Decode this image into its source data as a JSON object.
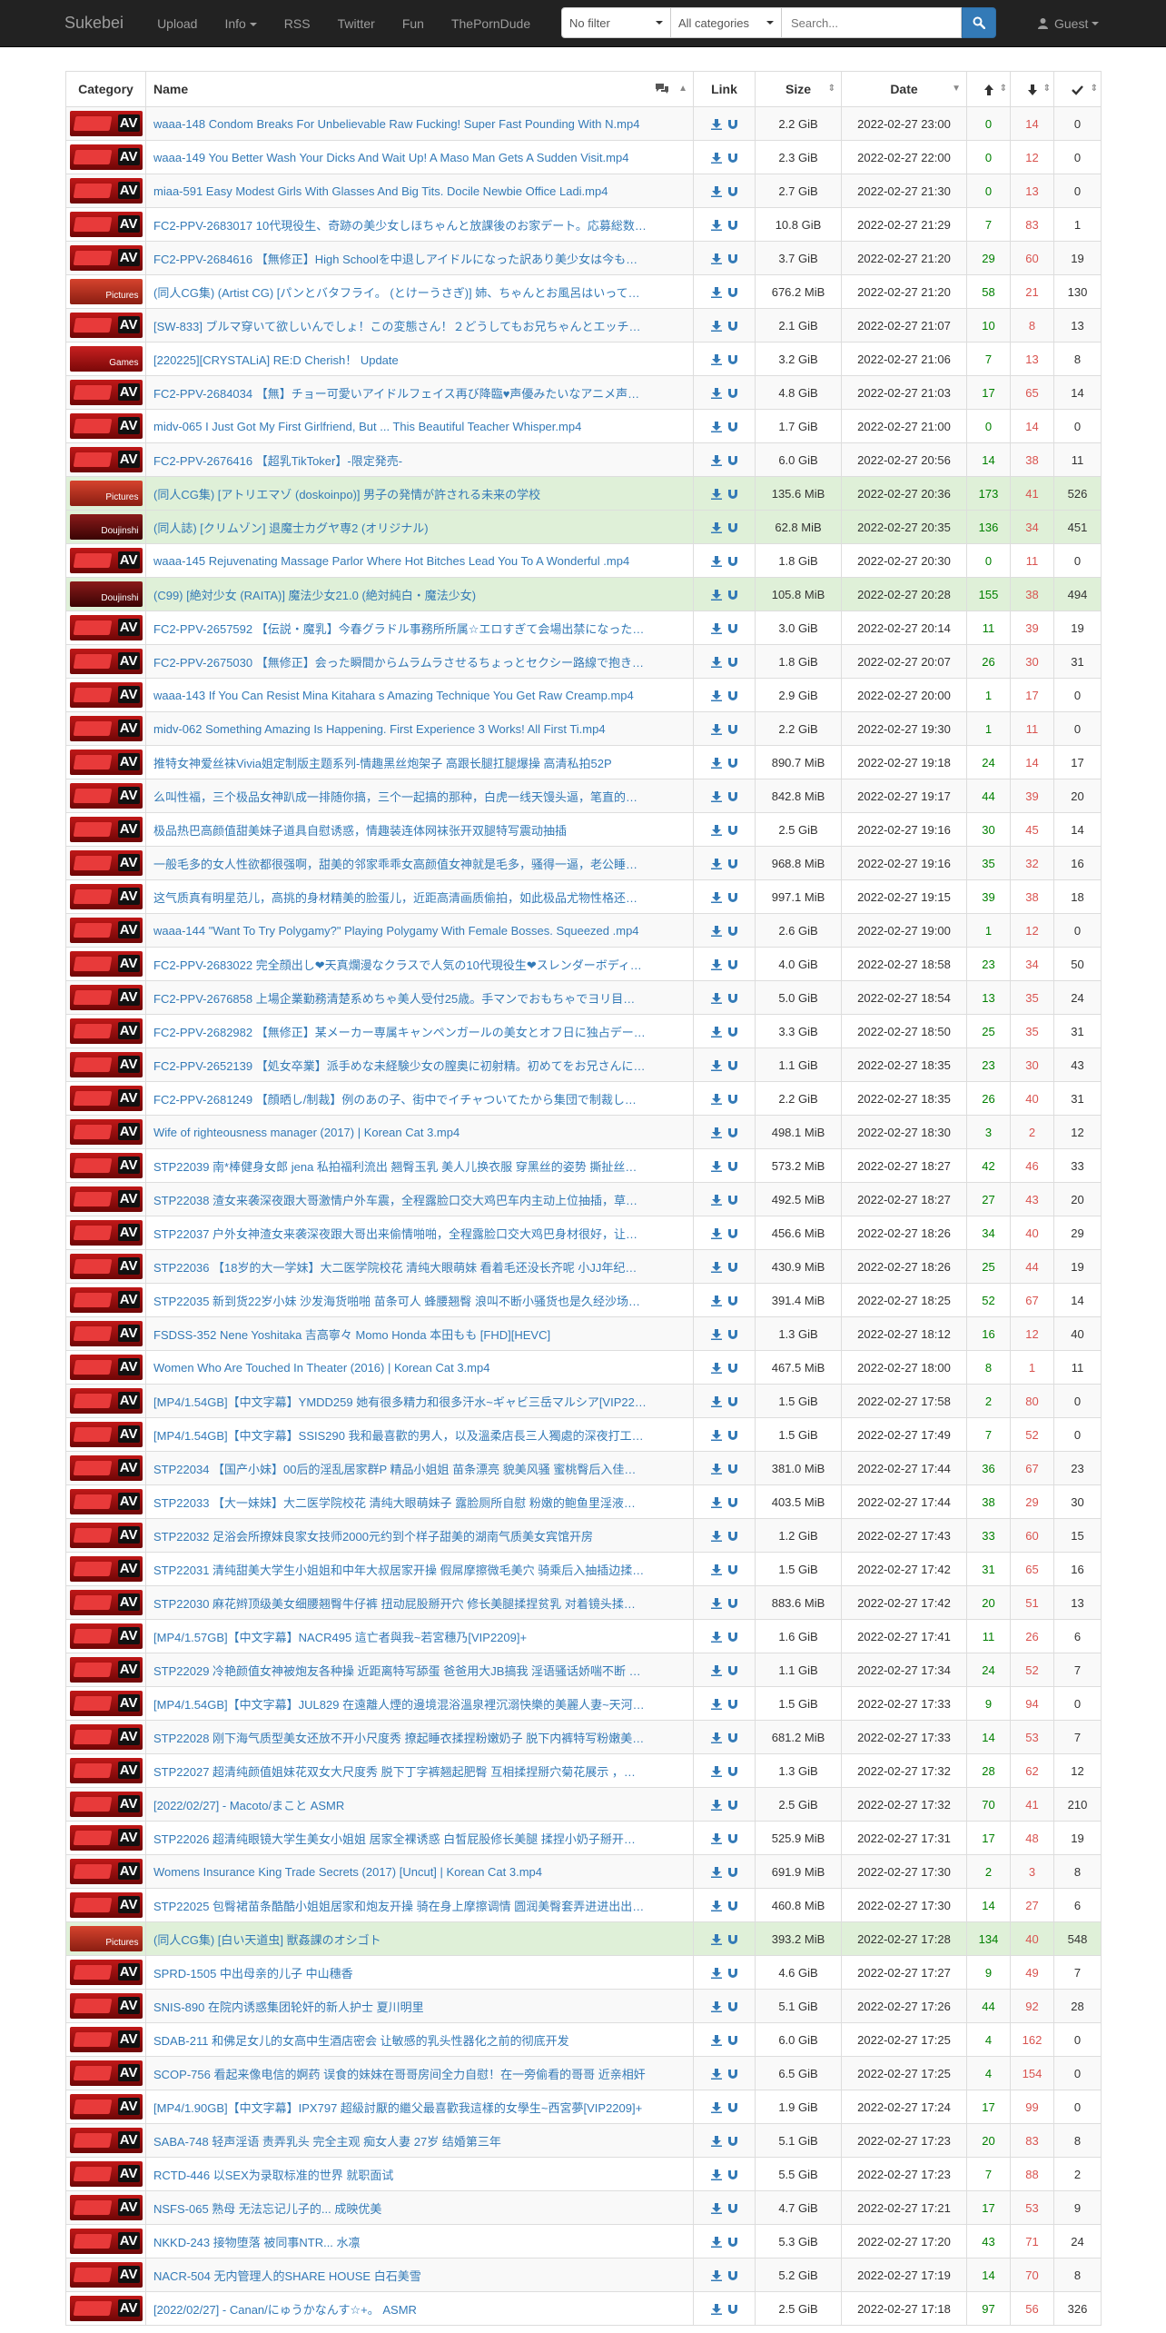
{
  "nav": {
    "brand": "Sukebei",
    "links": [
      "Upload",
      "Info",
      "RSS",
      "Twitter",
      "Fun",
      "ThePornDude"
    ],
    "filter": "No filter",
    "category": "All categories",
    "search_placeholder": "Search...",
    "user": "Guest"
  },
  "table": {
    "headers": {
      "category": "Category",
      "name": "Name",
      "link": "Link",
      "size": "Size",
      "date": "Date"
    },
    "rows": [
      {
        "cat": "AV",
        "name": "waaa-148 Condom Breaks For Unbelievable Raw Fucking! Super Fast Pounding With N.mp4",
        "size": "2.2 GiB",
        "date": "2022-02-27 23:00",
        "se": "0",
        "le": "14",
        "dl": "0",
        "success": false
      },
      {
        "cat": "AV",
        "name": "waaa-149 You Better Wash Your Dicks And Wait Up! A Maso Man Gets A Sudden Visit.mp4",
        "size": "2.3 GiB",
        "date": "2022-02-27 22:00",
        "se": "0",
        "le": "12",
        "dl": "0",
        "success": false
      },
      {
        "cat": "AV",
        "name": "miaa-591 Easy Modest Girls With Glasses And Big Tits. Docile Newbie Office Ladi.mp4",
        "size": "2.7 GiB",
        "date": "2022-02-27 21:30",
        "se": "0",
        "le": "13",
        "dl": "0",
        "success": false
      },
      {
        "cat": "AV",
        "name": "FC2-PPV-2683017 10代現役生、奇跡の美少女しほちゃんと放課後のお家デート。応募総数…",
        "size": "10.8 GiB",
        "date": "2022-02-27 21:29",
        "se": "7",
        "le": "83",
        "dl": "1",
        "success": false
      },
      {
        "cat": "AV",
        "name": "FC2-PPV-2684616 【無修正】High Schoolを中退しアイドルになった訳あり美少女は今も…",
        "size": "3.7 GiB",
        "date": "2022-02-27 21:20",
        "se": "29",
        "le": "60",
        "dl": "19",
        "success": false
      },
      {
        "cat": "Pictures",
        "name": "(同人CG集) (Artist CG) [パンとバタフライ。 (とけーうさぎ)] 姉、ちゃんとお風呂はいって…",
        "size": "676.2 MiB",
        "date": "2022-02-27 21:20",
        "se": "58",
        "le": "21",
        "dl": "130",
        "success": false
      },
      {
        "cat": "AV",
        "name": "[SW-833] ブルマ穿いて欲しいんでしょ！この変態さん！２どうしてもお兄ちゃんとエッチ…",
        "size": "2.1 GiB",
        "date": "2022-02-27 21:07",
        "se": "10",
        "le": "8",
        "dl": "13",
        "success": false
      },
      {
        "cat": "Games",
        "name": "[220225][CRYSTALiA] RE:D Cherish！ Update",
        "size": "3.2 GiB",
        "date": "2022-02-27 21:06",
        "se": "7",
        "le": "13",
        "dl": "8",
        "success": false
      },
      {
        "cat": "AV",
        "name": "FC2-PPV-2684034 【無】チョー可愛いアイドルフェイス再び降臨♥声優みたいなアニメ声…",
        "size": "4.8 GiB",
        "date": "2022-02-27 21:03",
        "se": "17",
        "le": "65",
        "dl": "14",
        "success": false
      },
      {
        "cat": "AV",
        "name": "midv-065 I Just Got My First Girlfriend, But ... This Beautiful Teacher Whisper.mp4",
        "size": "1.7 GiB",
        "date": "2022-02-27 21:00",
        "se": "0",
        "le": "14",
        "dl": "0",
        "success": false
      },
      {
        "cat": "AV",
        "name": "FC2-PPV-2676416 【超乳TikToker】-限定発売-",
        "size": "6.0 GiB",
        "date": "2022-02-27 20:56",
        "se": "14",
        "le": "38",
        "dl": "11",
        "success": false
      },
      {
        "cat": "Pictures",
        "name": "(同人CG集) [アトリエマゾ (doskoinpo)] 男子の発情が許される未来の学校",
        "size": "135.6 MiB",
        "date": "2022-02-27 20:36",
        "se": "173",
        "le": "41",
        "dl": "526",
        "success": true
      },
      {
        "cat": "Doujinshi",
        "name": "(同人誌) [クリムゾン] 退魔士カグヤ専2 (オリジナル)",
        "size": "62.8 MiB",
        "date": "2022-02-27 20:35",
        "se": "136",
        "le": "34",
        "dl": "451",
        "success": true
      },
      {
        "cat": "AV",
        "name": "waaa-145 Rejuvenating Massage Parlor Where Hot Bitches Lead You To A Wonderful .mp4",
        "size": "1.8 GiB",
        "date": "2022-02-27 20:30",
        "se": "0",
        "le": "11",
        "dl": "0",
        "success": false
      },
      {
        "cat": "Doujinshi",
        "name": "(C99) [絶対少女 (RAITA)] 魔法少女21.0 (絶対純白・魔法少女)",
        "size": "105.8 MiB",
        "date": "2022-02-27 20:28",
        "se": "155",
        "le": "38",
        "dl": "494",
        "success": true
      },
      {
        "cat": "AV",
        "name": "FC2-PPV-2657592 【伝説・魔乳】今春グラドル事務所所属☆エロすぎて会場出禁になった…",
        "size": "3.0 GiB",
        "date": "2022-02-27 20:14",
        "se": "11",
        "le": "39",
        "dl": "19",
        "success": false
      },
      {
        "cat": "AV",
        "name": "FC2-PPV-2675030 【無修正】会った瞬間からムラムラさせるちょっとセクシー路線で抱き…",
        "size": "1.8 GiB",
        "date": "2022-02-27 20:07",
        "se": "26",
        "le": "30",
        "dl": "31",
        "success": false
      },
      {
        "cat": "AV",
        "name": "waaa-143 If You Can Resist Mina Kitahara s Amazing Technique You Get Raw Creamp.mp4",
        "size": "2.9 GiB",
        "date": "2022-02-27 20:00",
        "se": "1",
        "le": "17",
        "dl": "0",
        "success": false
      },
      {
        "cat": "AV",
        "name": "midv-062 Something Amazing Is Happening. First Experience 3 Works! All First Ti.mp4",
        "size": "2.2 GiB",
        "date": "2022-02-27 19:30",
        "se": "1",
        "le": "11",
        "dl": "0",
        "success": false
      },
      {
        "cat": "AV",
        "name": "推特女神爱丝袜Vivia姐定制版主题系列-情趣黑丝炮架子 高跟长腿扛腿爆操 高清私拍52P",
        "size": "890.7 MiB",
        "date": "2022-02-27 19:18",
        "se": "24",
        "le": "14",
        "dl": "17",
        "success": false
      },
      {
        "cat": "AV",
        "name": "么叫性福，三个极品女神趴成一排随你搞，三个一起搞的那种，白虎一线天馒头逼，笔直的…",
        "size": "842.8 MiB",
        "date": "2022-02-27 19:17",
        "se": "44",
        "le": "39",
        "dl": "20",
        "success": false
      },
      {
        "cat": "AV",
        "name": "极品热巴高颜值甜美妹子道具自慰诱惑，情趣装连体网袜张开双腿特写震动抽插",
        "size": "2.5 GiB",
        "date": "2022-02-27 19:16",
        "se": "30",
        "le": "45",
        "dl": "14",
        "success": false
      },
      {
        "cat": "AV",
        "name": "一般毛多的女人性欲都很强啊，甜美的邻家乖乖女高颜值女神就是毛多，骚得一逼，老公睡…",
        "size": "968.8 MiB",
        "date": "2022-02-27 19:16",
        "se": "35",
        "le": "32",
        "dl": "16",
        "success": false
      },
      {
        "cat": "AV",
        "name": "这气质真有明星范儿，高挑的身材精美的脸蛋儿，近距高清画质偷拍，如此极品尤物性格还…",
        "size": "997.1 MiB",
        "date": "2022-02-27 19:15",
        "se": "39",
        "le": "38",
        "dl": "18",
        "success": false
      },
      {
        "cat": "AV",
        "name": "waaa-144 \"Want To Try Polygamy?\" Playing Polygamy With Female Bosses. Squeezed .mp4",
        "size": "2.6 GiB",
        "date": "2022-02-27 19:00",
        "se": "1",
        "le": "12",
        "dl": "0",
        "success": false
      },
      {
        "cat": "AV",
        "name": "FC2-PPV-2683022 完全顔出し❤天真爛漫なクラスで人気の10代現役生❤スレンダーボディ…",
        "size": "4.0 GiB",
        "date": "2022-02-27 18:58",
        "se": "23",
        "le": "34",
        "dl": "50",
        "success": false
      },
      {
        "cat": "AV",
        "name": "FC2-PPV-2676858 上場企業勤務清楚系めちゃ美人受付25歳。手マンでおもちゃでヨリ目…",
        "size": "5.0 GiB",
        "date": "2022-02-27 18:54",
        "se": "13",
        "le": "35",
        "dl": "24",
        "success": false
      },
      {
        "cat": "AV",
        "name": "FC2-PPV-2682982 【無修正】某メーカー専属キャンペンガールの美女とオフ日に独占デー…",
        "size": "3.3 GiB",
        "date": "2022-02-27 18:50",
        "se": "25",
        "le": "35",
        "dl": "31",
        "success": false
      },
      {
        "cat": "AV",
        "name": "FC2-PPV-2652139 【処女卒業】派手めな未経験少女の膣奥に初射精。初めてをお兄さんに…",
        "size": "1.1 GiB",
        "date": "2022-02-27 18:35",
        "se": "23",
        "le": "30",
        "dl": "43",
        "success": false
      },
      {
        "cat": "AV",
        "name": "FC2-PPV-2681249 【顔晒し/制裁】例のあの子、街中でイチャついてたから集団で制裁し…",
        "size": "2.2 GiB",
        "date": "2022-02-27 18:35",
        "se": "26",
        "le": "40",
        "dl": "31",
        "success": false
      },
      {
        "cat": "AV",
        "name": "Wife of righteousness manager (2017) | Korean Cat 3.mp4",
        "size": "498.1 MiB",
        "date": "2022-02-27 18:30",
        "se": "3",
        "le": "2",
        "dl": "12",
        "success": false
      },
      {
        "cat": "AV",
        "name": "STP22039 南*棒健身女郎 jena 私拍福利流出 翘臀玉乳 美人儿换衣服 穿黑丝的姿势 撕扯丝…",
        "size": "573.2 MiB",
        "date": "2022-02-27 18:27",
        "se": "42",
        "le": "46",
        "dl": "33",
        "success": false
      },
      {
        "cat": "AV",
        "name": "STP22038 渣女来袭深夜跟大哥激情户外车震，全程露脸口交大鸡巴车内主动上位抽插，草…",
        "size": "492.5 MiB",
        "date": "2022-02-27 18:27",
        "se": "27",
        "le": "43",
        "dl": "20",
        "success": false
      },
      {
        "cat": "AV",
        "name": "STP22037 户外女神渣女来袭深夜跟大哥出来偷情啪啪，全程露脸口交大鸡巴身材很好，让…",
        "size": "456.6 MiB",
        "date": "2022-02-27 18:26",
        "se": "34",
        "le": "40",
        "dl": "29",
        "success": false
      },
      {
        "cat": "AV",
        "name": "STP22036 【18岁的大一学妹】大二医学院校花 清纯大眼萌妹 看着毛还没长齐呢 小JJ年纪…",
        "size": "430.9 MiB",
        "date": "2022-02-27 18:26",
        "se": "25",
        "le": "44",
        "dl": "19",
        "success": false
      },
      {
        "cat": "AV",
        "name": "STP22035 新到货22岁小妹 沙发海货啪啪 苗条可人 蜂腰翘臀 浪叫不断小骚货也是久经沙场…",
        "size": "391.4 MiB",
        "date": "2022-02-27 18:25",
        "se": "52",
        "le": "67",
        "dl": "14",
        "success": false
      },
      {
        "cat": "AV",
        "name": "FSDSS-352 Nene Yoshitaka 吉高寧々 Momo Honda 本田もも [FHD][HEVC]",
        "size": "1.3 GiB",
        "date": "2022-02-27 18:12",
        "se": "16",
        "le": "12",
        "dl": "40",
        "success": false
      },
      {
        "cat": "AV",
        "name": "Women Who Are Touched In Theater (2016) | Korean Cat 3.mp4",
        "size": "467.5 MiB",
        "date": "2022-02-27 18:00",
        "se": "8",
        "le": "1",
        "dl": "11",
        "success": false
      },
      {
        "cat": "AV",
        "name": "[MP4/1.54GB]【中文字幕】YMDD259 她有很多精力和很多汗水~ギャビ三岳マルシア[VIP22…",
        "size": "1.5 GiB",
        "date": "2022-02-27 17:58",
        "se": "2",
        "le": "80",
        "dl": "0",
        "success": false
      },
      {
        "cat": "AV",
        "name": "[MP4/1.54GB]【中文字幕】SSIS290 我和最喜歡的男人，以及溫柔店長三人獨處的深夜打工…",
        "size": "1.5 GiB",
        "date": "2022-02-27 17:49",
        "se": "7",
        "le": "52",
        "dl": "0",
        "success": false
      },
      {
        "cat": "AV",
        "name": "STP22034 【国产小妹】00后的淫乱居家群P 精品小姐姐 苗条漂亮 貌美风骚 蜜桃臀后入佳…",
        "size": "381.0 MiB",
        "date": "2022-02-27 17:44",
        "se": "36",
        "le": "67",
        "dl": "23",
        "success": false
      },
      {
        "cat": "AV",
        "name": "STP22033 【大一妹妹】大二医学院校花 清纯大眼萌妹子 露脸厕所自慰 粉嫩的鲍鱼里淫液…",
        "size": "403.5 MiB",
        "date": "2022-02-27 17:44",
        "se": "38",
        "le": "29",
        "dl": "30",
        "success": false
      },
      {
        "cat": "AV",
        "name": "STP22032 足浴会所撩妹良家女技师2000元约到个样子甜美的湖南气质美女宾馆开房",
        "size": "1.2 GiB",
        "date": "2022-02-27 17:43",
        "se": "33",
        "le": "60",
        "dl": "15",
        "success": false
      },
      {
        "cat": "AV",
        "name": "STP22031 清纯甜美大学生小姐姐和中年大叔居家开操 假屌摩擦微毛美穴 骑乘后入抽插边揉…",
        "size": "1.5 GiB",
        "date": "2022-02-27 17:42",
        "se": "31",
        "le": "65",
        "dl": "16",
        "success": false
      },
      {
        "cat": "AV",
        "name": "STP22030 麻花辫顶级美女细腰翘臀牛仔裤 扭动屁股掰开穴 修长美腿揉捏贫乳 对着镜头揉…",
        "size": "883.6 MiB",
        "date": "2022-02-27 17:42",
        "se": "20",
        "le": "51",
        "dl": "13",
        "success": false
      },
      {
        "cat": "AV",
        "name": "[MP4/1.57GB]【中文字幕】NACR495 這亡者與我~若宮穗乃[VIP2209]+",
        "size": "1.6 GiB",
        "date": "2022-02-27 17:41",
        "se": "11",
        "le": "26",
        "dl": "6",
        "success": false
      },
      {
        "cat": "AV",
        "name": "STP22029 冷艳颜值女神被炮友各种操 近距离特写舔蛋 爸爸用大JB搞我 淫语骚话娇喘不断 …",
        "size": "1.1 GiB",
        "date": "2022-02-27 17:34",
        "se": "24",
        "le": "52",
        "dl": "7",
        "success": false
      },
      {
        "cat": "AV",
        "name": "[MP4/1.54GB]【中文字幕】JUL829 在遠離人煙的邊境混浴溫泉裡沉溺快樂的美麗人妻~天河…",
        "size": "1.5 GiB",
        "date": "2022-02-27 17:33",
        "se": "9",
        "le": "94",
        "dl": "0",
        "success": false
      },
      {
        "cat": "AV",
        "name": "STP22028 刚下海气质型美女还放不开小尺度秀 撩起睡衣揉捏粉嫩奶子 脱下内裤特写粉嫩美…",
        "size": "681.2 MiB",
        "date": "2022-02-27 17:33",
        "se": "14",
        "le": "53",
        "dl": "7",
        "success": false
      },
      {
        "cat": "AV",
        "name": "STP22027 超清纯颜值姐妹花双女大尺度秀 脱下丁字裤翘起肥臀 互相揉捏掰穴菊花展示 ，…",
        "size": "1.3 GiB",
        "date": "2022-02-27 17:32",
        "se": "28",
        "le": "62",
        "dl": "12",
        "success": false
      },
      {
        "cat": "AV",
        "name": "[2022/02/27] - Macoto/まこと ASMR",
        "size": "2.5 GiB",
        "date": "2022-02-27 17:32",
        "se": "70",
        "le": "41",
        "dl": "210",
        "success": false
      },
      {
        "cat": "AV",
        "name": "STP22026 超清纯眼镜大学生美女小姐姐 居家全裸诱惑 白皙屁股修长美腿 揉捏小奶子掰开…",
        "size": "525.9 MiB",
        "date": "2022-02-27 17:31",
        "se": "17",
        "le": "48",
        "dl": "19",
        "success": false
      },
      {
        "cat": "AV",
        "name": "Womens Insurance King Trade Secrets (2017) [Uncut] | Korean Cat 3.mp4",
        "size": "691.9 MiB",
        "date": "2022-02-27 17:30",
        "se": "2",
        "le": "3",
        "dl": "8",
        "success": false
      },
      {
        "cat": "AV",
        "name": "STP22025 包臀裙苗条酷酷小姐姐居家和炮友开操 骑在身上摩擦调情 圆润美臀套弄进进出出…",
        "size": "460.8 MiB",
        "date": "2022-02-27 17:30",
        "se": "14",
        "le": "27",
        "dl": "6",
        "success": false
      },
      {
        "cat": "Pictures",
        "name": "(同人CG集) [白い天道虫] 獣姦課のオシゴト",
        "size": "393.2 MiB",
        "date": "2022-02-27 17:28",
        "se": "134",
        "le": "40",
        "dl": "548",
        "success": true
      },
      {
        "cat": "AV",
        "name": "SPRD-1505 中出母亲的儿子 中山穗香",
        "size": "4.6 GiB",
        "date": "2022-02-27 17:27",
        "se": "9",
        "le": "49",
        "dl": "7",
        "success": false
      },
      {
        "cat": "AV",
        "name": "SNIS-890 在院内诱惑集团轮奸的新人护士 夏川明里",
        "size": "5.1 GiB",
        "date": "2022-02-27 17:26",
        "se": "44",
        "le": "92",
        "dl": "28",
        "success": false
      },
      {
        "cat": "AV",
        "name": "SDAB-211 和佛足女儿的女高中生酒店密会 让敏感的乳头性器化之前的彻底开发",
        "size": "6.0 GiB",
        "date": "2022-02-27 17:25",
        "se": "4",
        "le": "162",
        "dl": "0",
        "success": false
      },
      {
        "cat": "AV",
        "name": "SCOP-756 看起来像电信的婀药 误食的妹妹在哥哥房间全力自慰！在一旁偷看的哥哥 近亲相奸",
        "size": "6.5 GiB",
        "date": "2022-02-27 17:25",
        "se": "4",
        "le": "154",
        "dl": "0",
        "success": false
      },
      {
        "cat": "AV",
        "name": "[MP4/1.90GB]【中文字幕】IPX797 超級討厭的繼父最喜歡我這樣的女學生~西宮夢[VIP2209]+",
        "size": "1.9 GiB",
        "date": "2022-02-27 17:24",
        "se": "17",
        "le": "99",
        "dl": "0",
        "success": false
      },
      {
        "cat": "AV",
        "name": "SABA-748 轻声淫语 责弄乳头 完全主观 痴女人妻 27岁 结婚第三年",
        "size": "5.1 GiB",
        "date": "2022-02-27 17:23",
        "se": "20",
        "le": "83",
        "dl": "8",
        "success": false
      },
      {
        "cat": "AV",
        "name": "RCTD-446 以SEX为录取标准的世界 就职面试",
        "size": "5.5 GiB",
        "date": "2022-02-27 17:23",
        "se": "7",
        "le": "88",
        "dl": "2",
        "success": false
      },
      {
        "cat": "AV",
        "name": "NSFS-065 熟母 无法忘记儿子的... 成映优美",
        "size": "4.7 GiB",
        "date": "2022-02-27 17:21",
        "se": "17",
        "le": "53",
        "dl": "9",
        "success": false
      },
      {
        "cat": "AV",
        "name": "NKKD-243 接物堕落 被同事NTR... 水凛",
        "size": "5.3 GiB",
        "date": "2022-02-27 17:20",
        "se": "43",
        "le": "71",
        "dl": "24",
        "success": false
      },
      {
        "cat": "AV",
        "name": "NACR-504 无内管理人的SHARE HOUSE 白石美雪",
        "size": "5.2 GiB",
        "date": "2022-02-27 17:19",
        "se": "14",
        "le": "70",
        "dl": "8",
        "success": false
      },
      {
        "cat": "AV",
        "name": "[2022/02/27] - Canan/にゅうかなんす☆+。 ASMR",
        "size": "2.5 GiB",
        "date": "2022-02-27 17:18",
        "se": "97",
        "le": "56",
        "dl": "326",
        "success": false
      }
    ]
  }
}
